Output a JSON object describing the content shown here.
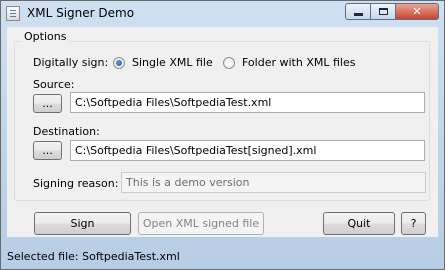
{
  "window": {
    "title": "XML Signer Demo"
  },
  "options": {
    "group_title": "Options",
    "digitally_sign_label": "Digitally sign:",
    "single_file_label": "Single XML file",
    "folder_label": "Folder with XML files",
    "selected_mode": "single"
  },
  "source": {
    "label": "Source:",
    "browse_label": "...",
    "value": "C:\\Softpedia Files\\SoftpediaTest.xml"
  },
  "destination": {
    "label": "Destination:",
    "browse_label": "...",
    "value": "C:\\Softpedia Files\\SoftpediaTest[signed].xml"
  },
  "reason": {
    "label": "Signing reason:",
    "placeholder": "This is a demo version"
  },
  "buttons": {
    "sign": "Sign",
    "open_signed": "Open XML signed file",
    "quit": "Quit",
    "help": "?"
  },
  "status": {
    "text": "Selected file: SoftpediaTest.xml"
  }
}
